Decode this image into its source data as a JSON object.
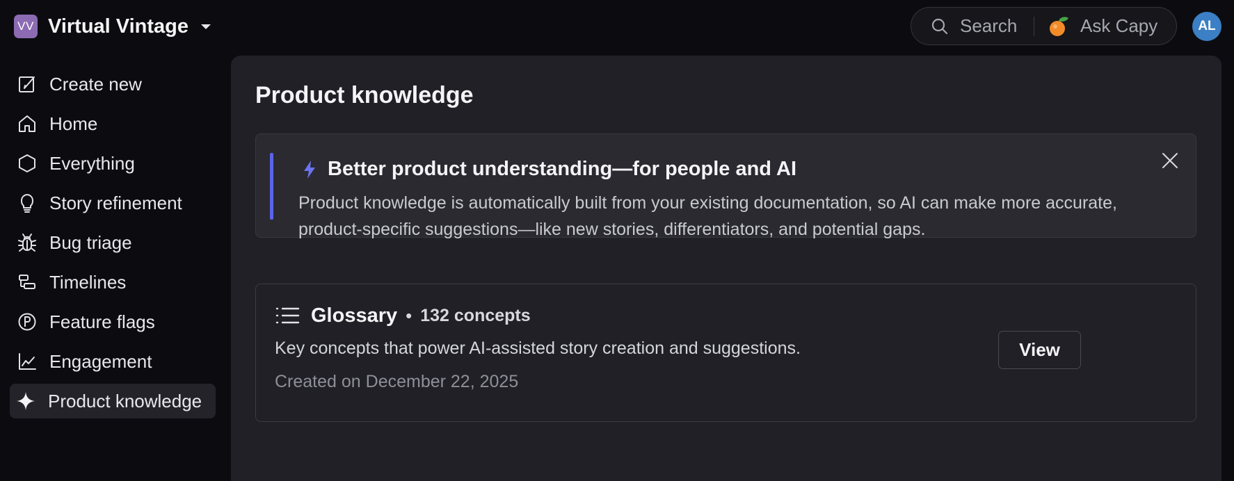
{
  "workspace": {
    "initials": "VV",
    "name": "Virtual Vintage",
    "logo_color": "#8c6bb3"
  },
  "topbar": {
    "search_label": "Search",
    "ask_label": "Ask Capy",
    "avatar_initials": "AL",
    "avatar_color": "#3b7fc4"
  },
  "sidebar": {
    "items": [
      {
        "label": "Create new",
        "icon": "compose-icon"
      },
      {
        "label": "Home",
        "icon": "home-icon"
      },
      {
        "label": "Everything",
        "icon": "hexagon-icon"
      },
      {
        "label": "Story refinement",
        "icon": "lightbulb-icon"
      },
      {
        "label": "Bug triage",
        "icon": "bug-icon"
      },
      {
        "label": "Timelines",
        "icon": "timeline-icon"
      },
      {
        "label": "Feature flags",
        "icon": "flag-circle-icon"
      },
      {
        "label": "Engagement",
        "icon": "line-chart-icon"
      },
      {
        "label": "Product knowledge",
        "icon": "sparkle-icon",
        "active": true
      }
    ]
  },
  "main": {
    "title": "Product knowledge",
    "banner": {
      "title": "Better product understanding—for people and AI",
      "text": "Product knowledge is automatically built from your existing documentation, so AI can make more accurate, product-specific suggestions—like new stories, differentiators, and potential gaps.",
      "accent_color": "#5b63e8"
    },
    "glossary": {
      "title": "Glossary",
      "separator": "•",
      "count": "132 concepts",
      "description": "Key concepts that power AI-assisted story creation and suggestions.",
      "created": "Created on December 22, 2025",
      "view_label": "View"
    }
  }
}
